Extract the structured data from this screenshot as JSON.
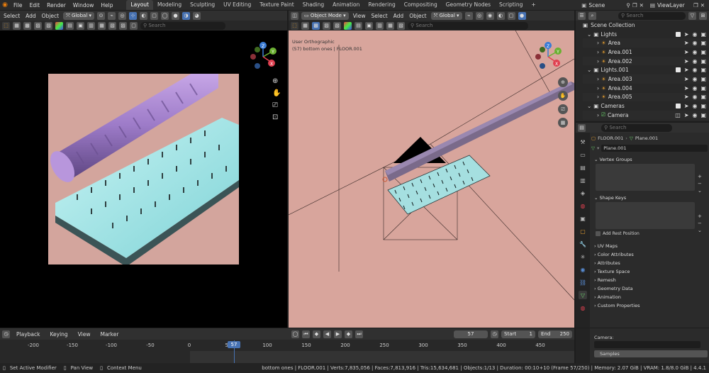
{
  "app": {
    "menus": [
      "File",
      "Edit",
      "Render",
      "Window",
      "Help"
    ],
    "workspaces": [
      "Layout",
      "Modeling",
      "Sculpting",
      "UV Editing",
      "Texture Paint",
      "Shading",
      "Animation",
      "Rendering",
      "Compositing",
      "Geometry Nodes",
      "Scripting"
    ],
    "active_workspace": "Layout",
    "scene": "Scene",
    "view_layer": "ViewLayer"
  },
  "left_viewport": {
    "menus": [
      "Select",
      "Add",
      "Object"
    ],
    "orientation": "Global",
    "search_placeholder": "Search"
  },
  "right_viewport": {
    "mode": "Object Mode",
    "menus": [
      "View",
      "Select",
      "Add",
      "Object"
    ],
    "orientation": "Global",
    "search_placeholder": "Search",
    "overlay_line1": "User Orthographic",
    "overlay_line2": "(57) bottom ones | FLOOR.001"
  },
  "gizmo": {
    "x": "X",
    "y": "Y",
    "z": "Z"
  },
  "outliner": {
    "search_placeholder": "Search",
    "root": "Scene Collection",
    "rows": [
      {
        "label": "Lights",
        "type": "collection",
        "level": 0
      },
      {
        "label": "Area",
        "type": "light",
        "level": 1
      },
      {
        "label": "Area.001",
        "type": "light",
        "level": 1
      },
      {
        "label": "Area.002",
        "type": "light",
        "level": 1
      },
      {
        "label": "Lights.001",
        "type": "collection",
        "level": 0
      },
      {
        "label": "Area.003",
        "type": "light",
        "level": 1
      },
      {
        "label": "Area.004",
        "type": "light",
        "level": 1
      },
      {
        "label": "Area.005",
        "type": "light",
        "level": 1
      },
      {
        "label": "Cameras",
        "type": "collection",
        "level": 0
      },
      {
        "label": "Camera",
        "type": "camera",
        "level": 1
      }
    ]
  },
  "properties": {
    "search_placeholder": "Search",
    "breadcrumb_object": "FLOOR.001",
    "breadcrumb_mesh": "Plane.001",
    "mesh_name": "Plane.001",
    "vertex_groups": "Vertex Groups",
    "shape_keys": "Shape Keys",
    "add_rest_position": "Add Rest Position",
    "sections": [
      "UV Maps",
      "Color Attributes",
      "Attributes",
      "Texture Space",
      "Remesh",
      "Geometry Data",
      "Animation",
      "Custom Properties"
    ]
  },
  "lower_props": {
    "camera_label": "Camera:",
    "samples_label": "Samples"
  },
  "timeline": {
    "menus": [
      "Playback",
      "Keying",
      "View",
      "Marker"
    ],
    "current_frame": "57",
    "start_label": "Start",
    "start": "1",
    "end_label": "End",
    "end": "250",
    "ticks": [
      "-200",
      "-150",
      "-100",
      "-50",
      "0",
      "50",
      "100",
      "150",
      "200",
      "250",
      "300",
      "350",
      "400",
      "450"
    ],
    "playhead": "57"
  },
  "statusbar": {
    "items": [
      "Set Active Modifier",
      "Pan View",
      "Context Menu"
    ],
    "scene_info": "bottom ones | FLOOR.001 | Verts:7,835,056 | Faces:7,813,916 | Tris:15,634,681 | Objects:1/13 | Duration: 00:10+10 (Frame 57/250) | Memory: 2.07 GiB | VRAM: 1.8/8.0 GiB | 4.4.1"
  }
}
